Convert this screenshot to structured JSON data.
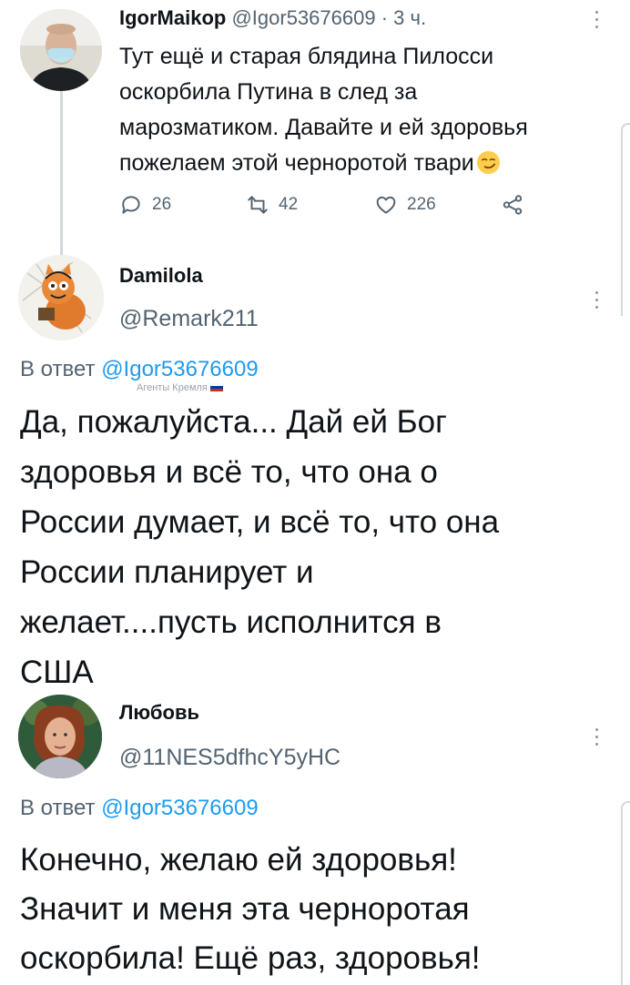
{
  "tweet1": {
    "name": "IgorMaikop",
    "handle": "@Igor53676609",
    "time": "· 3 ч.",
    "text_lines": [
      "Тут ещё и старая блядина Пилосси",
      "оскорбила Путина в след за",
      "марозматиком. Давайте и ей здоровья",
      "пожелаем этой черноротой твари"
    ],
    "emoji": "smirking-face",
    "actions": {
      "replies": "26",
      "retweets": "42",
      "likes": "226"
    }
  },
  "reply1": {
    "name": "Damilola",
    "handle": "@Remark211",
    "reply_prefix": "В ответ",
    "reply_to": "@Igor53676609",
    "watermark": "Агенты Кремля",
    "text_lines": [
      "Да, пожалуйста... Дай ей Бог",
      "здоровья и всё то, что она о",
      "России думает, и всё то, что она",
      "России планирует и",
      "желает....пусть исполнится в",
      "США"
    ]
  },
  "reply2": {
    "name": "Любовь",
    "handle": "@11NES5dfhcY5yHC",
    "reply_prefix": "В ответ",
    "reply_to": "@Igor53676609",
    "text_lines": [
      "Конечно, желаю ей здоровья!",
      "Значит и меня эта черноротая",
      "оскорбила! Ещё раз, здоровья!"
    ]
  }
}
